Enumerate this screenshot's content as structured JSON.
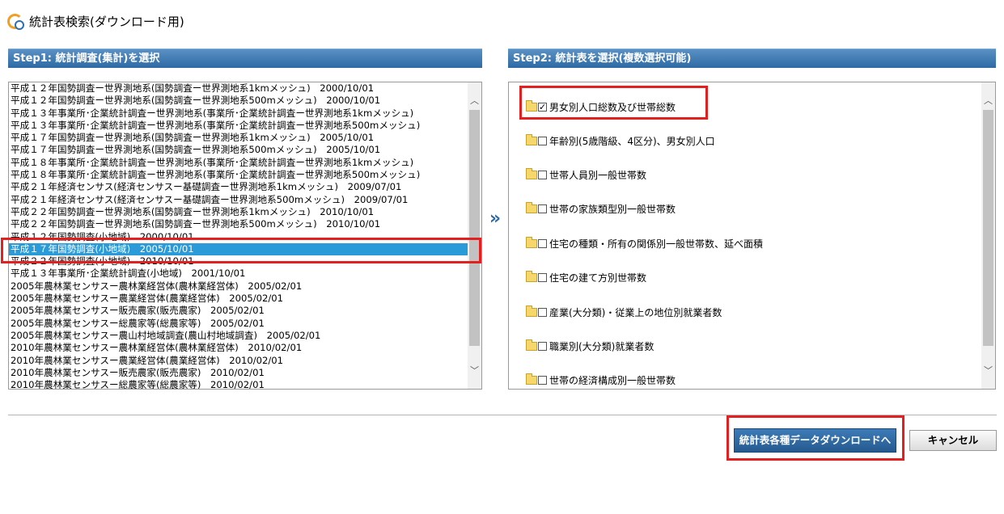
{
  "page": {
    "title": "統計表検索(ダウンロード用)"
  },
  "step1": {
    "header": "Step1: 統計調査(集計)を選択",
    "items": [
      "平成１２年国勢調査ー世界測地系(国勢調査ー世界測地系1kmメッシュ)　2000/10/01",
      "平成１２年国勢調査ー世界測地系(国勢調査ー世界測地系500mメッシュ)　2000/10/01",
      "平成１３年事業所･企業統計調査ー世界測地系(事業所･企業統計調査ー世界測地系1kmメッシュ)",
      "平成１３年事業所･企業統計調査ー世界測地系(事業所･企業統計調査ー世界測地系500mメッシュ)",
      "平成１７年国勢調査ー世界測地系(国勢調査ー世界測地系1kmメッシュ)　2005/10/01",
      "平成１７年国勢調査ー世界測地系(国勢調査ー世界測地系500mメッシュ)　2005/10/01",
      "平成１８年事業所･企業統計調査ー世界測地系(事業所･企業統計調査ー世界測地系1kmメッシュ)",
      "平成１８年事業所･企業統計調査ー世界測地系(事業所･企業統計調査ー世界測地系500mメッシュ)",
      "平成２１年経済センサス(経済センサスー基礎調査ー世界測地系1kmメッシュ)　2009/07/01",
      "平成２１年経済センサス(経済センサスー基礎調査ー世界測地系500mメッシュ)　2009/07/01",
      "平成２２年国勢調査ー世界測地系(国勢調査ー世界測地系1kmメッシュ)　2010/10/01",
      "平成２２年国勢調査ー世界測地系(国勢調査ー世界測地系500mメッシュ)　2010/10/01",
      "平成１２年国勢調査(小地域)　2000/10/01",
      "平成１７年国勢調査(小地域)　2005/10/01",
      "平成２２年国勢調査(小地域)　2010/10/01",
      "平成１３年事業所･企業統計調査(小地域)　2001/10/01",
      "2005年農林業センサスー農林業経営体(農林業経営体)　2005/02/01",
      "2005年農林業センサスー農業経営体(農業経営体)　2005/02/01",
      "2005年農林業センサスー販売農家(販売農家)　2005/02/01",
      "2005年農林業センサスー総農家等(総農家等)　2005/02/01",
      "2005年農林業センサスー農山村地域調査(農山村地域調査)　2005/02/01",
      "2010年農林業センサスー農林業経営体(農林業経営体)　2010/02/01",
      "2010年農林業センサスー農業経営体(農業経営体)　2010/02/01",
      "2010年農林業センサスー販売農家(販売農家)　2010/02/01",
      "2010年農林業センサスー総農家等(総農家等)　2010/02/01"
    ]
  },
  "step2": {
    "header": "Step2: 統計表を選択(複数選択可能)",
    "items": [
      {
        "label": "男女別人口総数及び世帯総数",
        "checked": true
      },
      {
        "label": "年齢別(5歳階級、4区分)、男女別人口",
        "checked": false
      },
      {
        "label": "世帯人員別一般世帯数",
        "checked": false
      },
      {
        "label": "世帯の家族類型別一般世帯数",
        "checked": false
      },
      {
        "label": "住宅の種類・所有の関係別一般世帯数、延べ面積",
        "checked": false
      },
      {
        "label": "住宅の建て方別世帯数",
        "checked": false
      },
      {
        "label": "産業(大分類)・従業上の地位別就業者数",
        "checked": false
      },
      {
        "label": "職業別(大分類)就業者数",
        "checked": false
      },
      {
        "label": "世帯の経済構成別一般世帯数",
        "checked": false
      }
    ]
  },
  "separator_arrow": "»",
  "buttons": {
    "download": "統計表各種データダウンロードへ",
    "cancel": "キャンセル"
  },
  "colors": {
    "header_blue": "#2e6aa5",
    "selected_row": "#2a9bd8",
    "highlight_red": "#e1201f"
  }
}
